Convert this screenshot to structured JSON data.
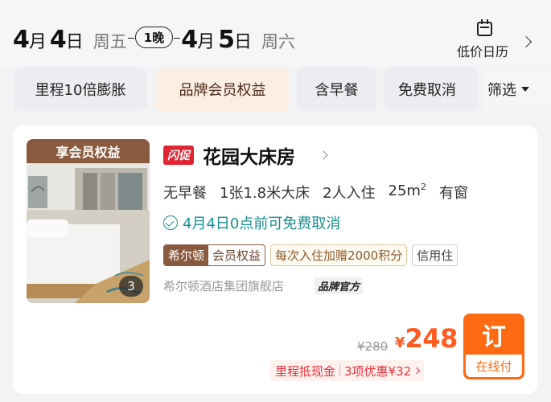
{
  "dates": {
    "checkin_month": "4",
    "checkin_day": "4",
    "checkin_weekday": "周五",
    "nights": "1晚",
    "checkout_month": "4",
    "checkout_day": "5",
    "checkout_weekday": "周六",
    "month_unit": "月",
    "day_unit": "日"
  },
  "calendar": {
    "label": "低价日历"
  },
  "chips": [
    "里程10倍膨胀",
    "品牌会员权益",
    "含早餐",
    "免费取消"
  ],
  "filter": {
    "label": "筛选"
  },
  "room": {
    "photo_tag": "享会员权益",
    "photo_count": "3",
    "flash_tag": "闪促",
    "name": "花园大床房",
    "specs": [
      "无早餐",
      "1张1.8米大床",
      "2人入住",
      "25m",
      "有窗"
    ],
    "area_sup": "2",
    "cancel_text": "4月4日0点前可免费取消",
    "brand_tag": "希尔顿",
    "member_tag": "会员权益",
    "points_tag": "每次入住加赠2000积分",
    "credit_tag": "信用住",
    "store_text": "希尔顿酒店集团旗舰店",
    "official_badge": "品牌官方"
  },
  "price": {
    "original": "¥280",
    "currency": "¥",
    "current": "248",
    "book_label": "订",
    "book_sub": "在线付",
    "mileage": "里程抵现金",
    "discount": "3项优惠¥32"
  },
  "colors": {
    "accent": "#ff6a13",
    "price": "#ff5a1f",
    "brand": "#8a5a3e",
    "teal": "#1a8f8f"
  }
}
